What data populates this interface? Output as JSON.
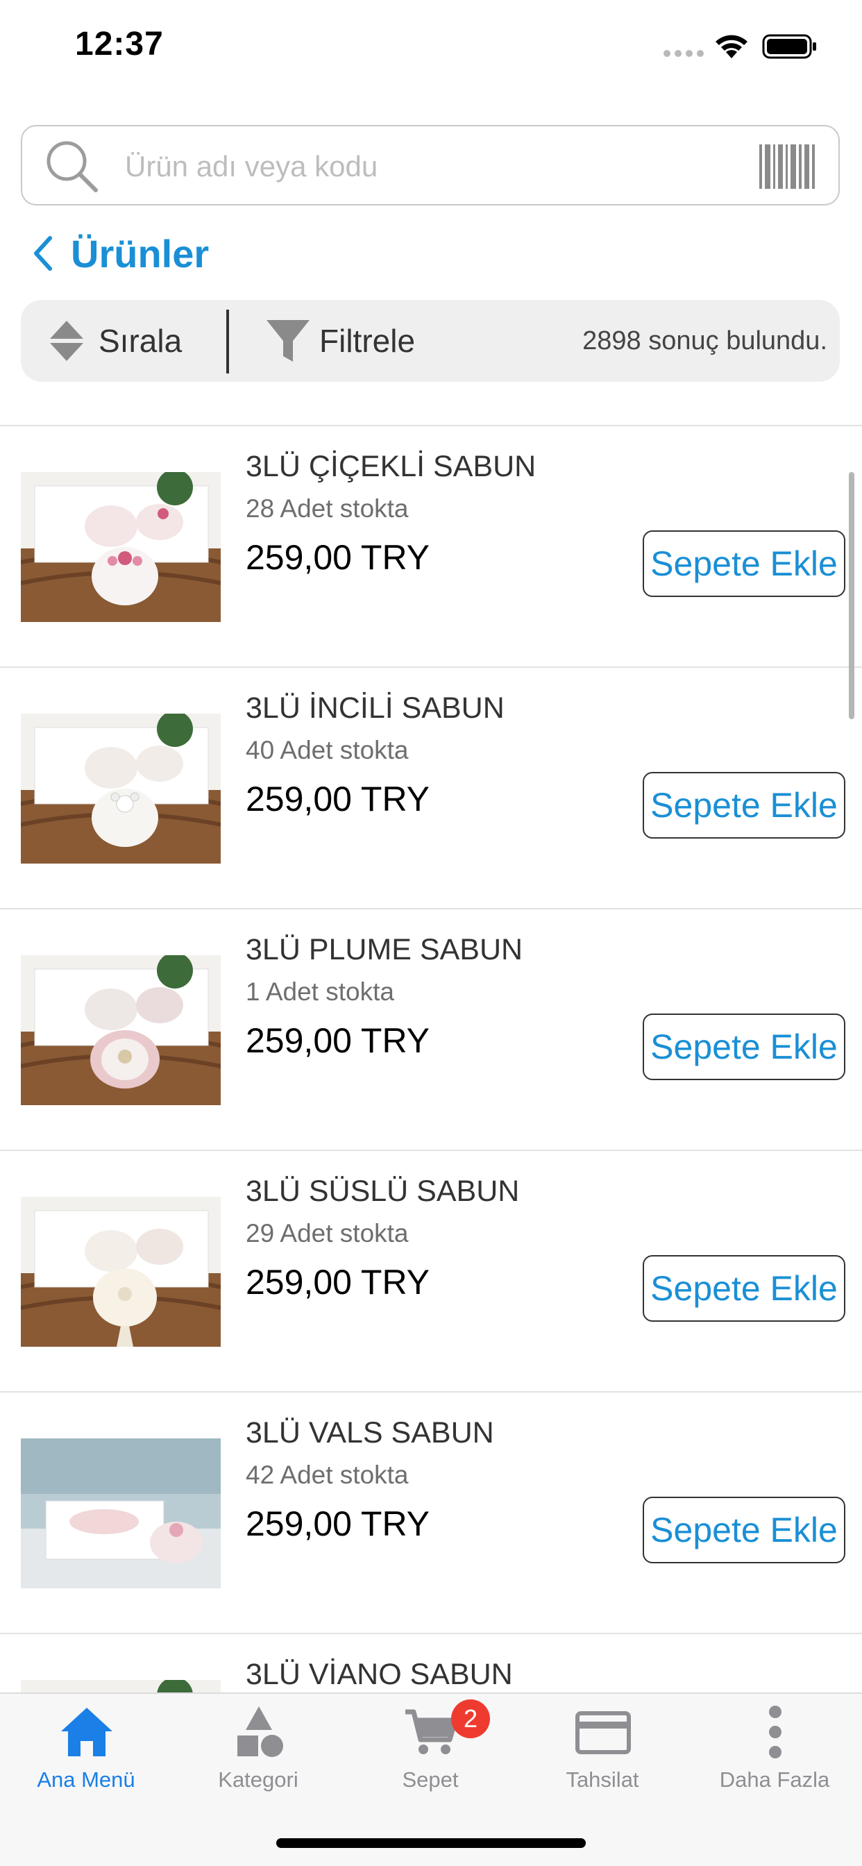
{
  "status_bar": {
    "time": "12:37"
  },
  "search": {
    "placeholder": "Ürün adı veya kodu"
  },
  "header": {
    "back_title": "Ürünler"
  },
  "toolbar": {
    "sort_label": "Sırala",
    "filter_label": "Filtrele",
    "result_count": "2898 sonuç bulundu."
  },
  "products": [
    {
      "name": "3LÜ ÇİÇEKLİ SABUN",
      "stock": "28 Adet stokta",
      "price": "259,00 TRY",
      "button": "Sepete Ekle"
    },
    {
      "name": "3LÜ İNCİLİ SABUN",
      "stock": "40 Adet stokta",
      "price": "259,00 TRY",
      "button": "Sepete Ekle"
    },
    {
      "name": "3LÜ PLUME SABUN",
      "stock": "1 Adet stokta",
      "price": "259,00 TRY",
      "button": "Sepete Ekle"
    },
    {
      "name": "3LÜ SÜSLÜ SABUN",
      "stock": "29 Adet stokta",
      "price": "259,00 TRY",
      "button": "Sepete Ekle"
    },
    {
      "name": "3LÜ VALS SABUN",
      "stock": "42 Adet stokta",
      "price": "259,00 TRY",
      "button": "Sepete Ekle"
    },
    {
      "name": "3LÜ VİANO SABUN"
    }
  ],
  "tabs": [
    {
      "label": "Ana Menü",
      "icon": "home-icon",
      "active": true
    },
    {
      "label": "Kategori",
      "icon": "category-shapes-icon"
    },
    {
      "label": "Sepet",
      "icon": "cart-icon",
      "badge": "2"
    },
    {
      "label": "Tahsilat",
      "icon": "credit-card-icon"
    },
    {
      "label": "Daha Fazla",
      "icon": "more-vertical-icon"
    }
  ],
  "colors": {
    "accent": "#1a8fd6",
    "tab_active": "#1a7fe6",
    "badge": "#ef3b2f"
  }
}
